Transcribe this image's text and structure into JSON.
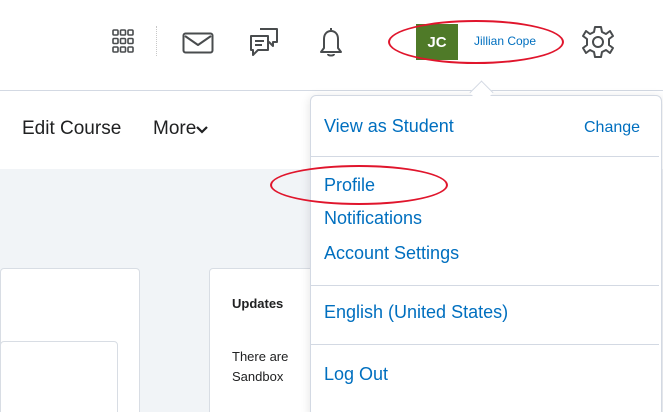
{
  "header": {
    "user_initials": "JC",
    "user_name": "Jillian Cope"
  },
  "nav": {
    "edit_course": "Edit Course",
    "more": "More"
  },
  "updates": {
    "title": "Updates",
    "text": "There are Sandbox"
  },
  "dropdown": {
    "view_as_student": "View as Student",
    "change": "Change",
    "profile": "Profile",
    "notifications": "Notifications",
    "account_settings": "Account Settings",
    "language": "English (United States)",
    "log_out": "Log Out"
  },
  "colors": {
    "link": "#006fbf",
    "avatar_bg": "#4f7a28",
    "annotation_red": "#e0152c",
    "content_bg": "#f1f4f7"
  },
  "icons": [
    "apps-grid-icon",
    "mail-icon",
    "chat-icon",
    "bell-icon",
    "gear-icon",
    "chevron-down-icon"
  ]
}
